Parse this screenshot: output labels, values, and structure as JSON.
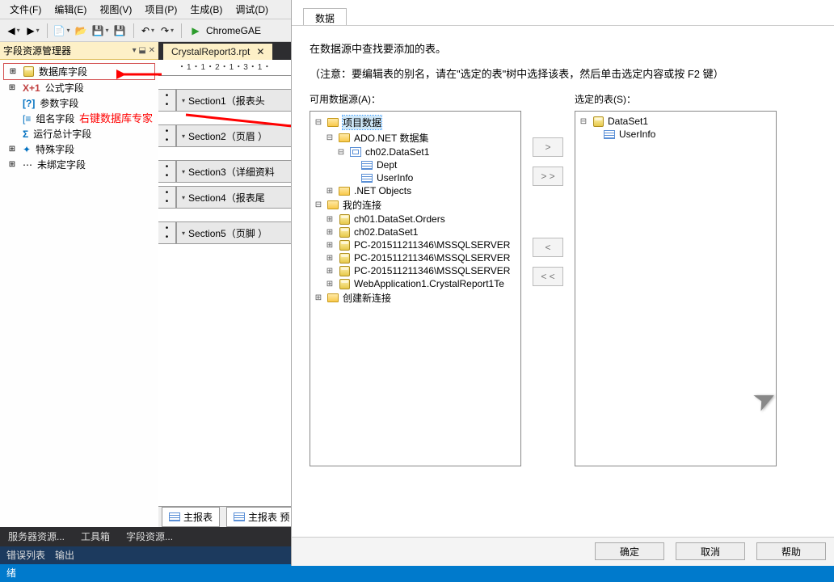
{
  "menu": {
    "file": "文件(F)",
    "edit": "编辑(E)",
    "view": "视图(V)",
    "project": "项目(P)",
    "build": "生成(B)",
    "debug": "调试(D)"
  },
  "toolbar": {
    "run_target": "ChromeGAE"
  },
  "panel": {
    "title": "字段资源管理器",
    "pin": "▾ ",
    "items": {
      "db": "数据库字段",
      "formula": "公式字段",
      "param": "参数字段",
      "group": "组名字段",
      "running": "运行总计字段",
      "special": "特殊字段",
      "unbound": "未绑定字段"
    }
  },
  "annotation": "右键数据库专家",
  "doc": {
    "tab": "CrystalReport3.rpt",
    "ruler": "・1・1・2・1・3・1・",
    "sections": {
      "s1": "Section1（报表头",
      "s2": "Section2（页眉 ）",
      "s3": "Section3（详细资料",
      "s4": "Section4（报表尾",
      "s5": "Section5（页脚 ）"
    },
    "bottom": {
      "main": "主报表",
      "preview": "主报表 预"
    }
  },
  "bottom_panels": {
    "server": "服务器资源...",
    "toolbox": "工具箱",
    "fields": "字段资源..."
  },
  "errors": "错误列表　输出",
  "status": "绪",
  "dialog": {
    "tab": "数据",
    "line1": "在数据源中查找要添加的表。",
    "line2": "（注意：要编辑表的别名，请在\"选定的表\"树中选择该表，然后单击选定内容或按 F2 键）",
    "left_label": "可用数据源(A)：",
    "right_label": "选定的表(S)：",
    "btn_add": ">",
    "btn_addall": "> >",
    "btn_remove": "<",
    "btn_removeall": "< <",
    "ok": "确定",
    "cancel": "取消",
    "help": "帮助",
    "left_tree": {
      "proj": "项目数据",
      "ado": "ADO.NET 数据集",
      "ds1": "ch02.DataSet1",
      "dept": "Dept",
      "userinfo": "UserInfo",
      "netobj": ".NET Objects",
      "myconn": "我的连接",
      "orders": "ch01.DataSet.Orders",
      "ds1b": "ch02.DataSet1",
      "pc1": "PC-201511211346\\MSSQLSERVER",
      "pc2": "PC-201511211346\\MSSQLSERVER",
      "pc3": "PC-201511211346\\MSSQLSERVER",
      "webapp": "WebApplication1.CrystalReport1Te",
      "newconn": "创建新连接"
    },
    "right_tree": {
      "ds": "DataSet1",
      "userinfo": "UserInfo"
    }
  }
}
